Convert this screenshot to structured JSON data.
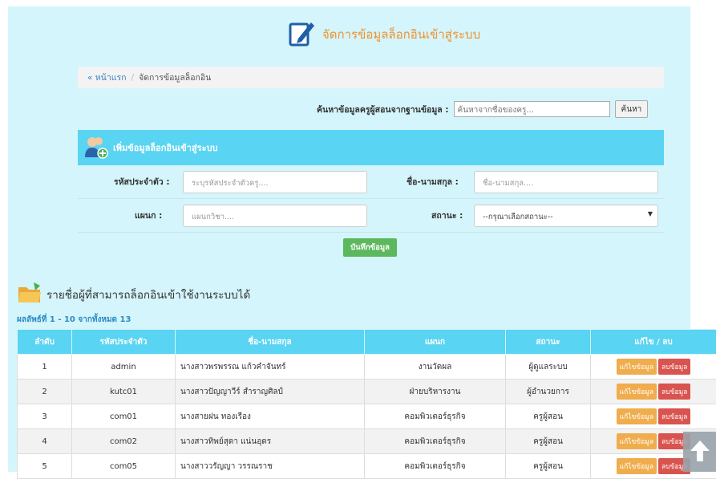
{
  "title": "จัดการข้อมูลล็อกอินเข้าสู่ระบบ",
  "breadcrumb": {
    "home": "« หน้าแรก",
    "sep": "/",
    "current": "จัดการข้อมูลล็อกอิน"
  },
  "search": {
    "label": "ค้นหาข้อมูลครูผู้สอนจากฐานข้อมูล :",
    "placeholder": "ค้นหาจากชื่อของครู...",
    "button": "ค้นหา"
  },
  "form": {
    "heading": "เพิ่มข้อมูลล็อกอินเข้าสู่ระบบ",
    "id_label": "รหัสประจำตัว :",
    "id_placeholder": "ระบุรหัสประจำตัวครู....",
    "name_label": "ชื่อ-นามสกุล :",
    "name_placeholder": "ชื่อ-นามสกุล....",
    "dept_label": "แผนก :",
    "dept_placeholder": "แผนกวิชา....",
    "status_label": "สถานะ :",
    "status_value": "--กรุณาเลือกสถานะ--",
    "save": "บันทึกข้อมูล"
  },
  "list": {
    "heading": "รายชื่อผู้ที่สามารถล็อกอินเข้าใช้งานระบบได้",
    "count": "ผลลัพธ์ที่ 1 - 10 จากทั้งหมด 13",
    "columns": [
      "ลำดับ",
      "รหัสประจำตัว",
      "ชื่อ-นามสกุล",
      "แผนก",
      "สถานะ",
      "แก้ไข / ลบ"
    ],
    "edit_label": "แก้ไขข้อมูล",
    "delete_label": "ลบข้อมูล",
    "rows": [
      {
        "no": "1",
        "id": "admin",
        "name": "นางสาวพรพรรณ แก้วคำจันทร์",
        "dept": "งานวัดผล",
        "status": "ผู้ดูแลระบบ"
      },
      {
        "no": "2",
        "id": "kutc01",
        "name": "นางสาวปัญญาวีร์ สำราญศิลป์",
        "dept": "ฝ่ายบริหารงาน",
        "status": "ผู้อำนวยการ"
      },
      {
        "no": "3",
        "id": "com01",
        "name": "นางสายฝน ทองเรือง",
        "dept": "คอมพิวเตอร์ธุรกิจ",
        "status": "ครูผู้สอน"
      },
      {
        "no": "4",
        "id": "com02",
        "name": "นางสาวทิพย์สุดา แน่นอุดร",
        "dept": "คอมพิวเตอร์ธุรกิจ",
        "status": "ครูผู้สอน"
      },
      {
        "no": "5",
        "id": "com05",
        "name": "นางสาววรัญญา วรรณราช",
        "dept": "คอมพิวเตอร์ธุรกิจ",
        "status": "ครูผู้สอน"
      }
    ]
  }
}
